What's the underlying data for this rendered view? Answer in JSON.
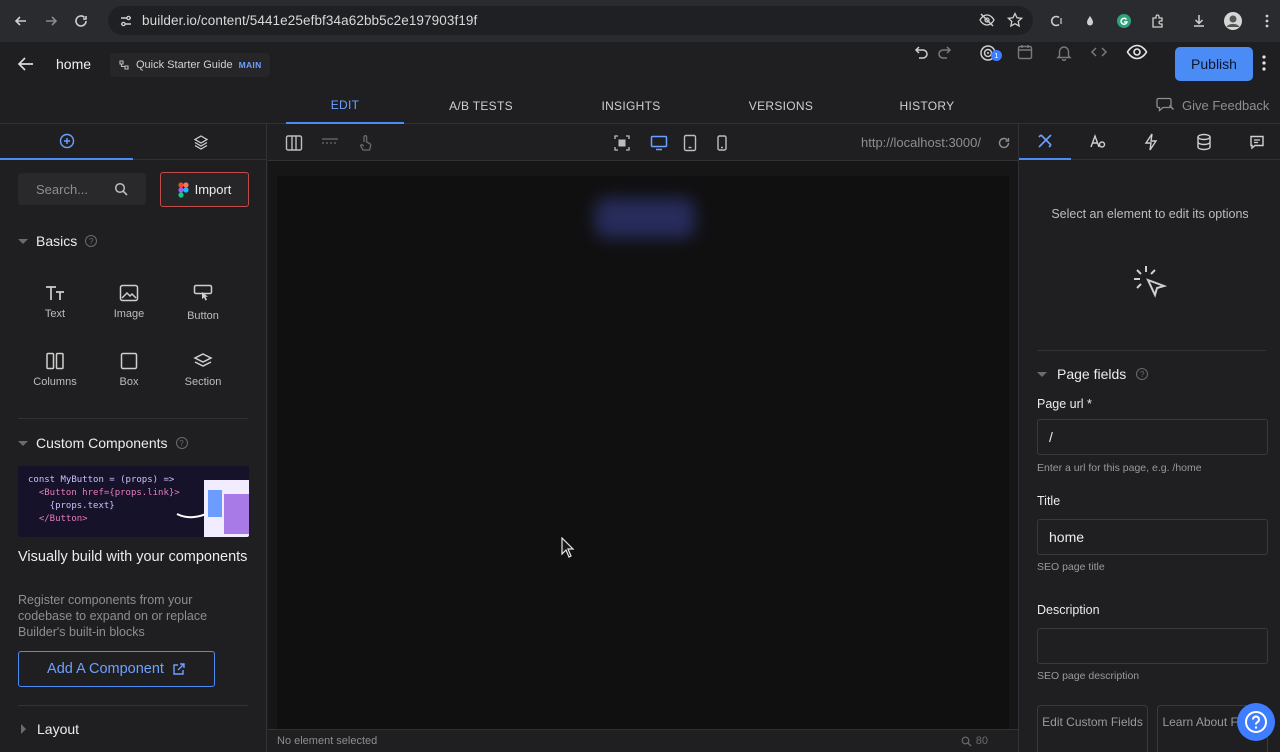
{
  "browser": {
    "url": "builder.io/content/5441e25efbf34a62bb5c2e197903f19f"
  },
  "header": {
    "page_name": "home",
    "branch_label": "Quick Starter Guide",
    "branch_badge": "MAIN",
    "notification_count": "1",
    "publish_label": "Publish"
  },
  "tabs": [
    {
      "label": "EDIT",
      "active": true
    },
    {
      "label": "A/B TESTS",
      "active": false
    },
    {
      "label": "INSIGHTS",
      "active": false
    },
    {
      "label": "VERSIONS",
      "active": false
    },
    {
      "label": "HISTORY",
      "active": false
    }
  ],
  "feedback_label": "Give Feedback",
  "left": {
    "search_placeholder": "Search...",
    "import_label": "Import",
    "basics": {
      "title": "Basics",
      "blocks": [
        {
          "label": "Text",
          "icon": "text-icon"
        },
        {
          "label": "Image",
          "icon": "image-icon"
        },
        {
          "label": "Button",
          "icon": "button-icon"
        },
        {
          "label": "Columns",
          "icon": "columns-icon"
        },
        {
          "label": "Box",
          "icon": "box-icon"
        },
        {
          "label": "Section",
          "icon": "section-icon"
        }
      ]
    },
    "custom": {
      "title": "Custom Components",
      "code_lines": [
        "const MyButton = (props) =>",
        "  <Button href={props.link}>",
        "    {props.text}",
        "  </Button>"
      ],
      "heading": "Visually build with your components",
      "description": "Register components from your codebase to expand on or replace Builder's built-in blocks",
      "add_label": "Add A Component"
    },
    "layout_title": "Layout"
  },
  "canvas": {
    "preview_url": "http://localhost:3000/",
    "status": "No element selected",
    "zoom": "80"
  },
  "right": {
    "select_message": "Select an element to edit its options",
    "page_fields_title": "Page fields",
    "page_url_label": "Page url *",
    "page_url_value": "/",
    "page_url_hint": "Enter a url for this page, e.g. /home",
    "title_label": "Title",
    "title_value": "home",
    "title_hint": "SEO page title",
    "description_label": "Description",
    "description_value": "",
    "description_hint": "SEO page description",
    "edit_custom_label": "Edit Custom Fields",
    "learn_about_label": "Learn About Fields"
  },
  "colors": {
    "accent": "#4b8bf5",
    "background": "#1f1f21",
    "canvas": "#101011"
  }
}
